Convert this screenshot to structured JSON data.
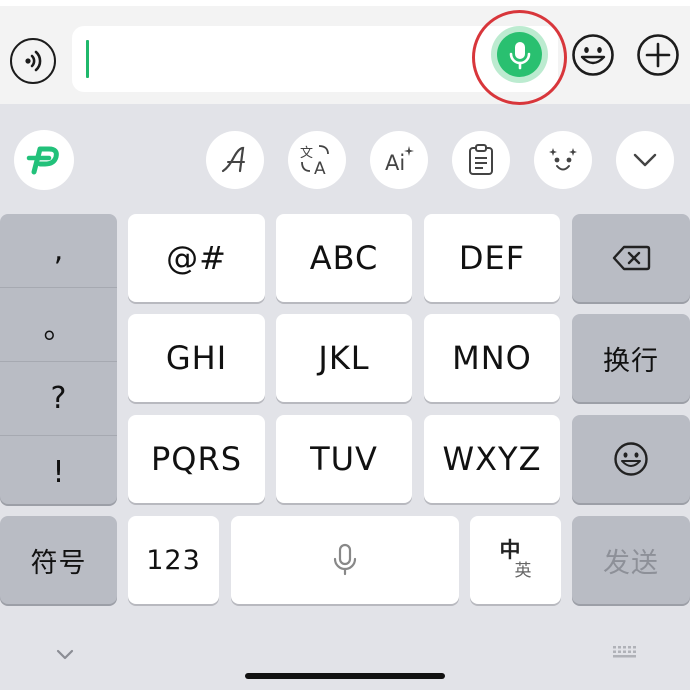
{
  "input": {
    "text_value": "",
    "accent_color": "#1fb86b",
    "mic_color": "#29c070",
    "highlight_color": "#d8363b"
  },
  "toolbar": {
    "logo_icon": "tencent-p-logo",
    "tools": [
      "font-style-icon",
      "translate-icon",
      "ai-icon",
      "clipboard-icon",
      "emoji-face-icon",
      "chevron-down-icon"
    ]
  },
  "keyboard": {
    "punctuation": [
      ",",
      "。",
      "?",
      "!"
    ],
    "rows": [
      [
        "@#",
        "ABC",
        "DEF"
      ],
      [
        "GHI",
        "JKL",
        "MNO"
      ],
      [
        "PQRS",
        "TUV",
        "WXYZ"
      ]
    ],
    "newline_label": "换行",
    "symbols_label": "符号",
    "numbers_label": "123",
    "lang_primary": "中",
    "lang_secondary": "英",
    "send_label": "发送"
  }
}
